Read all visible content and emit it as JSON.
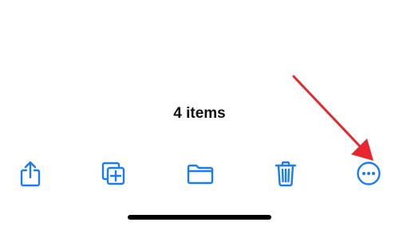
{
  "status": {
    "items_count": "4 items"
  },
  "toolbar": {
    "accent_color": "#1a7cf5",
    "buttons": [
      {
        "icon": "share-icon"
      },
      {
        "icon": "duplicate-icon"
      },
      {
        "icon": "folder-icon"
      },
      {
        "icon": "trash-icon"
      },
      {
        "icon": "more-icon"
      }
    ]
  },
  "annotation": {
    "arrow_color": "#e8262d",
    "points_to": "more-icon"
  }
}
